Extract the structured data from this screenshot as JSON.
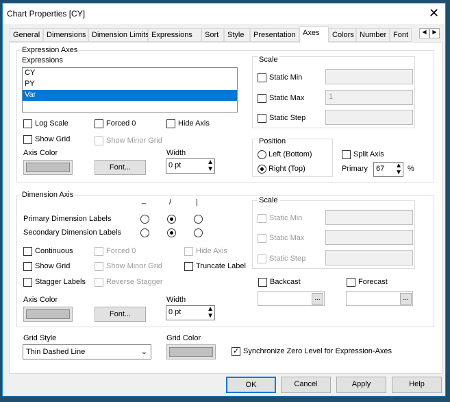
{
  "window": {
    "title": "Chart Properties [CY]"
  },
  "tabs": [
    "General",
    "Dimensions",
    "Dimension Limits",
    "Expressions",
    "Sort",
    "Style",
    "Presentation",
    "Axes",
    "Colors",
    "Number",
    "Font"
  ],
  "active_tab": "Axes",
  "expression_axes": {
    "title": "Expression Axes",
    "expressions_label": "Expressions",
    "expressions": [
      "CY",
      "PY",
      "Var"
    ],
    "selected": "Var",
    "log_scale": "Log Scale",
    "forced0": "Forced 0",
    "hide_axis": "Hide Axis",
    "show_grid": "Show Grid",
    "show_minor_grid": "Show Minor Grid",
    "axis_color": "Axis Color",
    "font_button": "Font...",
    "width_label": "Width",
    "width_value": "0 pt",
    "scale": {
      "title": "Scale",
      "static_min": "Static Min",
      "static_max": "Static Max",
      "static_max_value": "1",
      "static_step": "Static Step"
    },
    "position": {
      "title": "Position",
      "left": "Left (Bottom)",
      "right": "Right (Top)",
      "selected": "Right (Top)"
    },
    "split_axis": "Split Axis",
    "primary_label": "Primary",
    "primary_value": "67",
    "percent": "%"
  },
  "dimension_axis": {
    "title": "Dimension Axis",
    "orientation_headers": [
      "_",
      "/",
      "|"
    ],
    "primary_labels": "Primary Dimension Labels",
    "secondary_labels": "Secondary Dimension Labels",
    "primary_selected": 1,
    "secondary_selected": 1,
    "continuous": "Continuous",
    "forced0": "Forced 0",
    "hide_axis": "Hide Axis",
    "show_grid": "Show Grid",
    "show_minor_grid": "Show Minor Grid",
    "truncate_label": "Truncate Label",
    "stagger_labels": "Stagger Labels",
    "reverse_stagger": "Reverse Stagger",
    "axis_color": "Axis Color",
    "font_button": "Font...",
    "width_label": "Width",
    "width_value": "0 pt",
    "scale": {
      "title": "Scale",
      "static_min": "Static Min",
      "static_max": "Static Max",
      "static_step": "Static Step"
    },
    "backcast": "Backcast",
    "forecast": "Forecast",
    "ellipsis": "..."
  },
  "grid_style": {
    "label": "Grid Style",
    "value": "Thin Dashed Line"
  },
  "grid_color": {
    "label": "Grid Color"
  },
  "sync_zero": {
    "label": "Synchronize Zero Level for Expression-Axes",
    "checked": true
  },
  "buttons": {
    "ok": "OK",
    "cancel": "Cancel",
    "apply": "Apply",
    "help": "Help"
  }
}
